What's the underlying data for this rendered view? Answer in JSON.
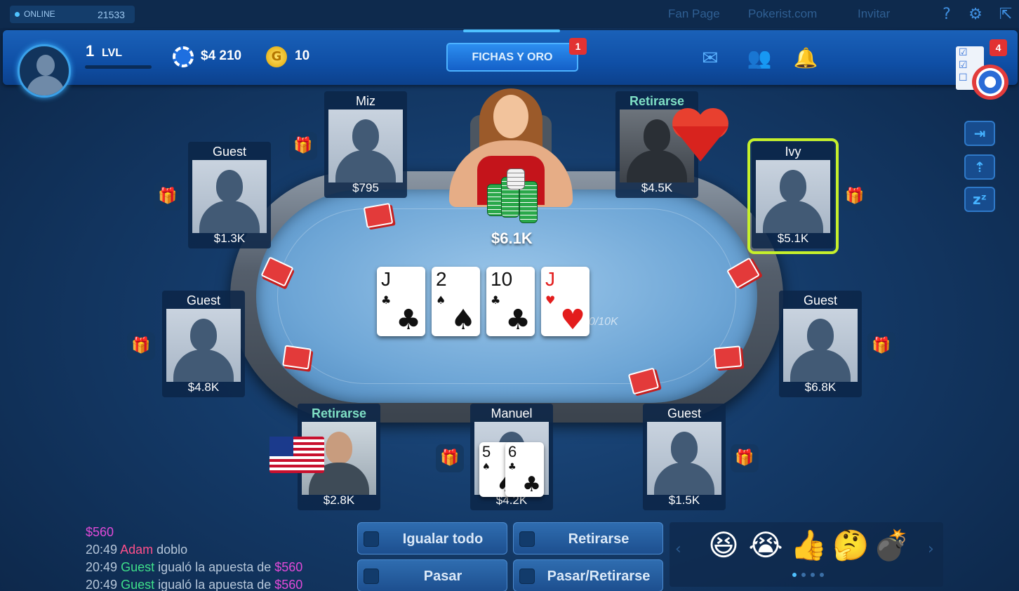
{
  "top": {
    "online_label": "ONLINE",
    "online_count": "21533",
    "links": [
      "Fan Page",
      "Pokerist.com",
      "Invitar"
    ]
  },
  "header": {
    "level_num": "1",
    "level_label": "LVL",
    "chips": "$4 210",
    "gold": "10",
    "gold_icon_letter": "G",
    "fichas_label": "FICHAS Y ORO",
    "fichas_badge": "1",
    "missions_badge": "4"
  },
  "table": {
    "pot": "$6.1K",
    "stakes": "00/10K",
    "community_cards": [
      {
        "rank": "J",
        "suit": "♣",
        "color": "#111111"
      },
      {
        "rank": "2",
        "suit": "♠",
        "color": "#111111"
      },
      {
        "rank": "10",
        "suit": "♣",
        "color": "#111111"
      },
      {
        "rank": "J",
        "suit": "♥",
        "color": "#e31d1d"
      }
    ]
  },
  "seats": {
    "miz": {
      "name": "Miz",
      "stack": "$795"
    },
    "retirarse_top": {
      "name": "Retirarse",
      "stack": "$4.5K"
    },
    "guest_top_left": {
      "name": "Guest",
      "stack": "$1.3K"
    },
    "ivy": {
      "name": "Ivy",
      "stack": "$5.1K"
    },
    "guest_mid_left": {
      "name": "Guest",
      "stack": "$4.8K"
    },
    "guest_mid_right": {
      "name": "Guest",
      "stack": "$6.8K"
    },
    "retirarse_bottom": {
      "name": "Retirarse",
      "stack": "$2.8K"
    },
    "manuel": {
      "name": "Manuel",
      "stack": "$4.2K"
    },
    "guest_bottom_right": {
      "name": "Guest",
      "stack": "$1.5K"
    }
  },
  "hole_cards": [
    {
      "rank": "5",
      "suit": "♠"
    },
    {
      "rank": "6",
      "suit": "♣"
    }
  ],
  "chat": [
    {
      "time": "",
      "name": "",
      "text": "",
      "amount": "$560"
    },
    {
      "time": "20:49",
      "name": "Adam",
      "text": "doblo",
      "amount": ""
    },
    {
      "time": "20:49",
      "name": "Guest",
      "text": "igualó la apuesta de",
      "amount": "$560"
    },
    {
      "time": "20:49",
      "name": "Guest",
      "text": "igualó la apuesta de",
      "amount": "$560"
    }
  ],
  "actions": {
    "call_all": "Igualar todo",
    "fold": "Retirarse",
    "check": "Pasar",
    "check_fold": "Pasar/Retirarse"
  },
  "emojis": [
    "😆",
    "😭",
    "👍",
    "🤔",
    "💣"
  ],
  "colors": {
    "accent": "#4fc1ff",
    "highlight": "#c6f02b",
    "badge": "#e23232"
  }
}
